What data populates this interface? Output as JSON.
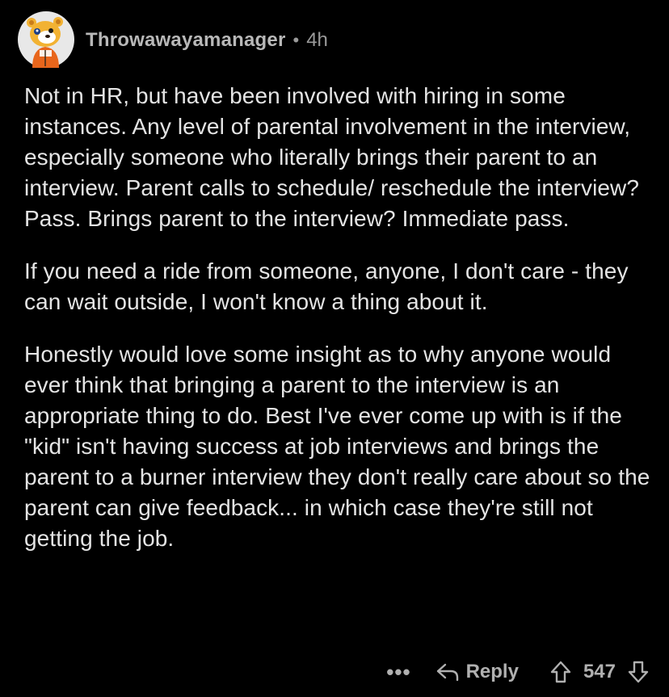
{
  "comment": {
    "author": "Throwawayamanager",
    "separator": "•",
    "age": "4h",
    "paragraphs": [
      "Not in HR, but have been involved with hiring in some instances. Any level of parental involvement in the interview, especially someone who literally brings their parent to an interview. Parent calls to schedule/ reschedule the interview? Pass. Brings parent to the interview? Immediate pass.",
      "If you need a ride from someone, anyone, I don't care - they can wait outside, I won't know a thing about it.",
      "Honestly would love some insight as to why anyone would ever think that bringing a parent to the interview is an appropriate thing to do. Best I've ever come up with is if the \"kid\" isn't having success at job interviews and brings the parent to a burner interview they don't really care about so the parent can give feedback... in which case they're still not getting the job."
    ]
  },
  "actions": {
    "more_label": "•••",
    "reply_label": "Reply",
    "score": "547"
  },
  "icons": {
    "avatar": "snoo-avatar-icon",
    "reply": "reply-arrow-icon",
    "upvote": "upvote-arrow-icon",
    "downvote": "downvote-arrow-icon"
  },
  "colors": {
    "background": "#000000",
    "text": "#e4e4e4",
    "muted": "#9a9a9a",
    "avatar_bg": "#e8e8e8",
    "avatar_accent": "#f2b233",
    "avatar_shirt": "#e8661c"
  }
}
